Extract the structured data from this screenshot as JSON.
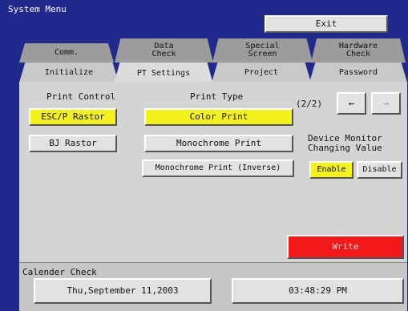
{
  "header": {
    "title": "System Menu",
    "exit_label": "Exit"
  },
  "tabs_row1": [
    {
      "label": "Comm."
    },
    {
      "label": "Data\nCheck"
    },
    {
      "label": "Special\nScreen"
    },
    {
      "label": "Hardware\nCheck"
    }
  ],
  "tabs_row2": [
    {
      "label": "Initialize"
    },
    {
      "label": "PT Settings",
      "active": true
    },
    {
      "label": "Project"
    },
    {
      "label": "Password"
    }
  ],
  "panel": {
    "print_control": {
      "heading": "Print Control",
      "options": [
        "ESC/P Rastor",
        "BJ Rastor"
      ],
      "selected": "ESC/P Rastor"
    },
    "print_type": {
      "heading": "Print Type",
      "options": [
        "Color Print",
        "Monochrome Print",
        "Monochrome Print (Inverse)"
      ],
      "selected": "Color Print"
    },
    "page_indicator": "(2/2)",
    "prev_label": "←",
    "next_label": "→",
    "device_monitor": {
      "heading": "Device Monitor\nChanging Value",
      "enable_label": "Enable",
      "disable_label": "Disable",
      "selected": "Enable"
    },
    "write_label": "Write"
  },
  "calendar": {
    "heading": "Calender Check",
    "date": "Thu,September 11,2003",
    "time": "03:48:29 PM"
  },
  "colors": {
    "background": "#1f2a8c",
    "panel": "#d4d4d4",
    "selected": "#f3f21e",
    "write": "#f01818"
  }
}
